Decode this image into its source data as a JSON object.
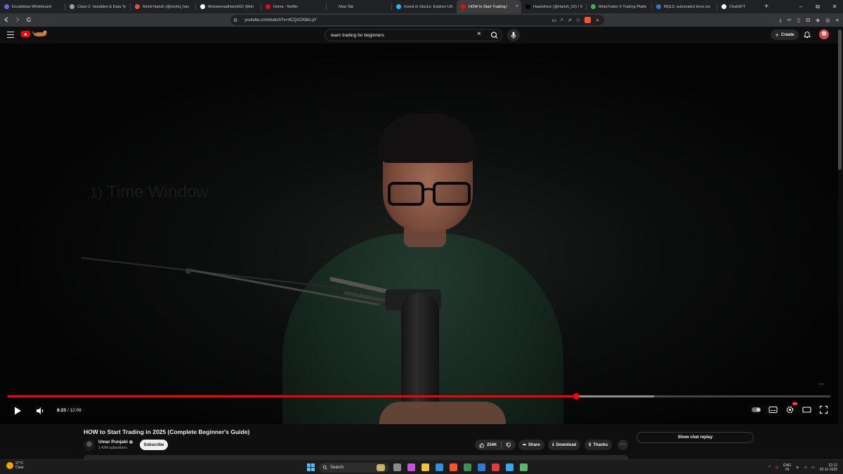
{
  "browser": {
    "tabs": [
      {
        "label": "Excalidraw Whiteboard",
        "color": "#6965db",
        "active": false
      },
      {
        "label": "Class 2: Variables & Data Ty",
        "color": "#9e9e9e",
        "active": false
      },
      {
        "label": "Mohd Harish (@mohd_harı",
        "color": "#e5533c",
        "active": false
      },
      {
        "label": "MohammadHarish52 (Moh",
        "color": "#ffffff",
        "active": false
      },
      {
        "label": "Home - Netflix",
        "color": "#e50914",
        "active": false
      },
      {
        "label": "New Tab",
        "color": "#202124",
        "active": false
      },
      {
        "label": "Invest in Stocks: Explore US",
        "color": "#2ab6f6",
        "active": false
      },
      {
        "label": "HOW to Start Trading i",
        "color": "#ff0000",
        "active": true
      },
      {
        "label": "Haarishvrs (@Harish_52) / X",
        "color": "#000000",
        "active": false
      },
      {
        "label": "MetaTrader 5 Trading Platfo",
        "color": "#3bb44a",
        "active": false
      },
      {
        "label": "MQL5: automated forex tra",
        "color": "#3277c4",
        "active": false
      },
      {
        "label": "ChatGPT",
        "color": "#ffffff",
        "active": false
      }
    ],
    "new_tab_symbol": "+",
    "url": "youtube.com/watch?v=4CQzOXbkLqY",
    "window_controls": [
      "–",
      "⧉",
      "✕"
    ],
    "brave_count": "2"
  },
  "youtube": {
    "search_query": "learn trading for beginners",
    "create_label": "Create",
    "accent": "#ff0000"
  },
  "player": {
    "overlay_text": "Time Window",
    "overlay_number": "1)",
    "current_time": "8:23",
    "duration": "12:08",
    "time_separator": " / ",
    "played_fraction": 0.691,
    "buffered_fraction": 0.786,
    "hd_badge": "HD"
  },
  "video": {
    "title": "HOW to Start Trading in 2025 (Complete Beginner's Guide)",
    "channel_name": "Umar Punjabi",
    "subscribers": "1.42M subscribers",
    "subscribe_label": "Subscribe",
    "likes": "254K",
    "share_label": "Share",
    "download_label": "Download",
    "thanks_label": "Thanks",
    "more_label": "···",
    "chat_replay_label": "Show chat replay"
  },
  "taskbar": {
    "temperature": "27°C",
    "weather": "Clear",
    "search_label": "Search",
    "language_top": "ENG",
    "language_bottom": "IN",
    "time": "22:12",
    "date": "03-11-2025",
    "app_colors": [
      "#8a8a8a",
      "#c94fe0",
      "#f3c13a",
      "#2f8fe0",
      "#fb542b",
      "#3c8f5a",
      "#2b7bd6",
      "#e23a3a",
      "#3ea3f2",
      "#5bb36d"
    ]
  }
}
